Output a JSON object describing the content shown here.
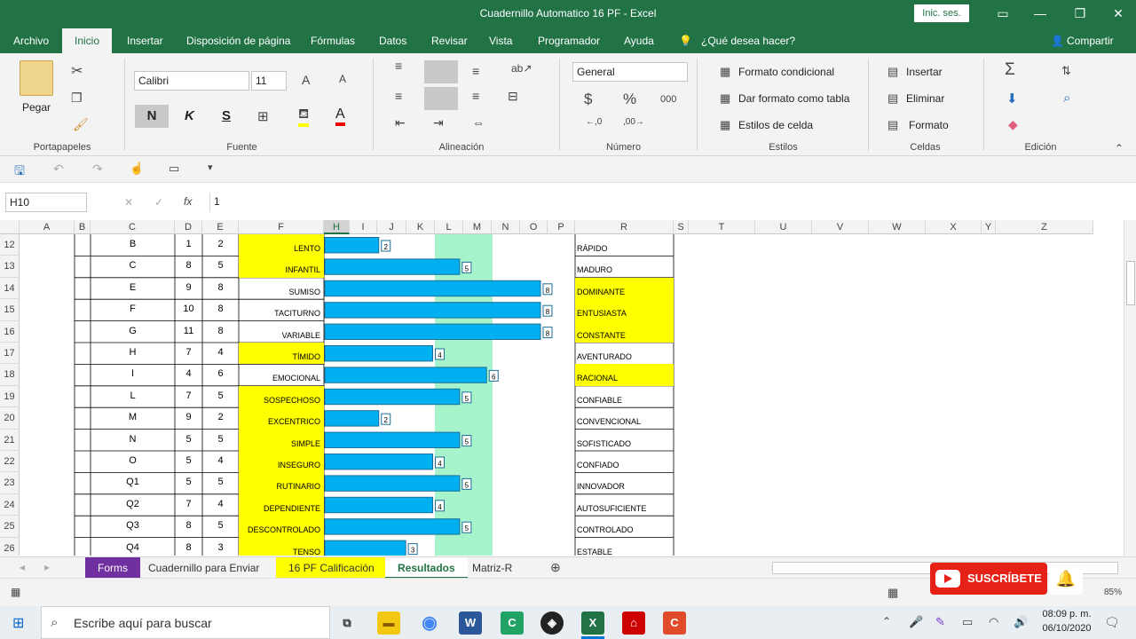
{
  "window": {
    "title": "Cuadernillo Automatico 16 PF  -  Excel",
    "signin": "Inic. ses."
  },
  "ribbon_tabs": [
    "Archivo",
    "Inicio",
    "Insertar",
    "Disposición de página",
    "Fórmulas",
    "Datos",
    "Revisar",
    "Vista",
    "Programador",
    "Ayuda"
  ],
  "tell_me": "¿Qué desea hacer?",
  "share": "Compartir",
  "clipboard": {
    "paste": "Pegar",
    "label": "Portapapeles"
  },
  "font": {
    "name": "Calibri",
    "size": "11",
    "bold": "N",
    "italic": "K",
    "underline": "S",
    "label": "Fuente"
  },
  "alignment": {
    "label": "Alineación"
  },
  "number": {
    "format": "General",
    "currency": "$",
    "percent": "%",
    "thousands": "000",
    "label": "Número"
  },
  "styles": {
    "conditional": "Formato condicional",
    "table": "Dar formato como tabla",
    "cell": "Estilos de celda",
    "label": "Estilos"
  },
  "cells": {
    "insert": "Insertar",
    "delete": "Eliminar",
    "format": "Formato",
    "label": "Celdas"
  },
  "editing": {
    "label": "Edición"
  },
  "formula_bar": {
    "name_box": "H10",
    "fx": "fx",
    "value": "1"
  },
  "columns": [
    "A",
    "B",
    "C",
    "D",
    "E",
    "F",
    "H",
    "I",
    "J",
    "K",
    "L",
    "M",
    "N",
    "O",
    "P",
    "R",
    "S",
    "T",
    "U",
    "V",
    "W",
    "X",
    "Y",
    "Z"
  ],
  "rows": [
    {
      "num": "12",
      "factor": "B",
      "d": "1",
      "e": "2",
      "left": "LENTO",
      "left_hl": true,
      "right": "RÁPIDO",
      "right_hl": false,
      "score": 2
    },
    {
      "num": "13",
      "factor": "C",
      "d": "8",
      "e": "5",
      "left": "INFANTIL",
      "left_hl": true,
      "right": "MADURO",
      "right_hl": false,
      "score": 5
    },
    {
      "num": "14",
      "factor": "E",
      "d": "9",
      "e": "8",
      "left": "SUMISO",
      "left_hl": false,
      "right": "DOMINANTE",
      "right_hl": true,
      "score": 8
    },
    {
      "num": "15",
      "factor": "F",
      "d": "10",
      "e": "8",
      "left": "TACITURNO",
      "left_hl": false,
      "right": "ENTUSIASTA",
      "right_hl": true,
      "score": 8
    },
    {
      "num": "16",
      "factor": "G",
      "d": "11",
      "e": "8",
      "left": "VARIABLE",
      "left_hl": false,
      "right": "CONSTANTE",
      "right_hl": true,
      "score": 8
    },
    {
      "num": "17",
      "factor": "H",
      "d": "7",
      "e": "4",
      "left": "TÍMIDO",
      "left_hl": true,
      "right": "AVENTURADO",
      "right_hl": false,
      "score": 4
    },
    {
      "num": "18",
      "factor": "I",
      "d": "4",
      "e": "6",
      "left": "EMOCIONAL",
      "left_hl": false,
      "right": "RACIONAL",
      "right_hl": true,
      "score": 6
    },
    {
      "num": "19",
      "factor": "L",
      "d": "7",
      "e": "5",
      "left": "SOSPECHOSO",
      "left_hl": true,
      "right": "CONFIABLE",
      "right_hl": false,
      "score": 5
    },
    {
      "num": "20",
      "factor": "M",
      "d": "9",
      "e": "2",
      "left": "EXCENTRICO",
      "left_hl": true,
      "right": "CONVENCIONAL",
      "right_hl": false,
      "score": 2
    },
    {
      "num": "21",
      "factor": "N",
      "d": "5",
      "e": "5",
      "left": "SIMPLE",
      "left_hl": true,
      "right": "SOFISTICADO",
      "right_hl": false,
      "score": 5
    },
    {
      "num": "22",
      "factor": "O",
      "d": "5",
      "e": "4",
      "left": "INSEGURO",
      "left_hl": true,
      "right": "CONFIADO",
      "right_hl": false,
      "score": 4
    },
    {
      "num": "23",
      "factor": "Q1",
      "d": "5",
      "e": "5",
      "left": "RUTINARIO",
      "left_hl": true,
      "right": "INNOVADOR",
      "right_hl": false,
      "score": 5
    },
    {
      "num": "24",
      "factor": "Q2",
      "d": "7",
      "e": "4",
      "left": "DEPENDIENTE",
      "left_hl": true,
      "right": "AUTOSUFICIENTE",
      "right_hl": false,
      "score": 4
    },
    {
      "num": "25",
      "factor": "Q3",
      "d": "8",
      "e": "5",
      "left": "DESCONTROLADO",
      "left_hl": true,
      "right": "CONTROLADO",
      "right_hl": false,
      "score": 5
    },
    {
      "num": "26",
      "factor": "Q4",
      "d": "8",
      "e": "3",
      "left": "TENSO",
      "left_hl": true,
      "right": "ESTABLE",
      "right_hl": false,
      "score": 3
    }
  ],
  "sheet_tabs": [
    "Forms",
    "Cuadernillo para Enviar",
    "16 PF Calificación",
    "Resultados",
    "Matriz-R"
  ],
  "zoom": "85%",
  "subscribe": "SUSCRÍBETE",
  "taskbar": {
    "search_placeholder": "Escribe aquí para buscar",
    "time": "08:09 p. m.",
    "date": "06/10/2020"
  },
  "colors": {
    "excel_green": "#217346",
    "bar_blue": "#00b0f0",
    "highlight_yellow": "#ffff00",
    "band_green": "#a6f3cc"
  }
}
